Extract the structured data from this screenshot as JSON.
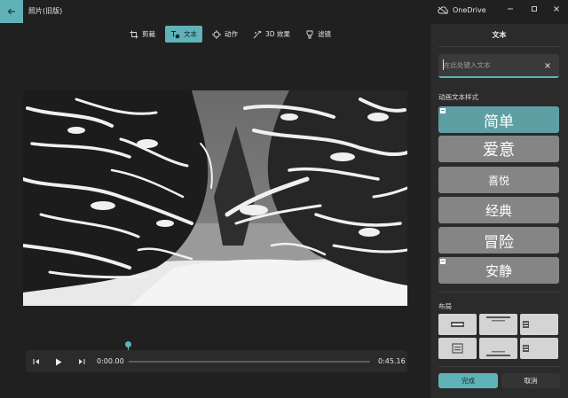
{
  "app": {
    "title": "照片(旧版)",
    "onedrive_label": "OneDrive"
  },
  "colors": {
    "accent": "#5fb3b8",
    "background": "#202020",
    "panel": "#2b2b2b",
    "style_button": "#858585"
  },
  "toolbar": {
    "tools": [
      {
        "label": "剪裁",
        "icon": "crop-icon",
        "active": false
      },
      {
        "label": "文本",
        "icon": "text-icon",
        "active": true
      },
      {
        "label": "动作",
        "icon": "motion-icon",
        "active": false
      },
      {
        "label": "3D 效果",
        "icon": "3d-effects-icon",
        "active": false
      },
      {
        "label": "滤镜",
        "icon": "filter-icon",
        "active": false
      }
    ]
  },
  "player": {
    "current_time": "0:00.00",
    "total_time": "0:45.16",
    "progress": 0
  },
  "panel": {
    "title": "文本",
    "text_input": {
      "value": "",
      "placeholder": "在此处键入文本"
    },
    "styles_label": "动画文本样式",
    "styles": [
      {
        "label": "简单",
        "selected": true
      },
      {
        "label": "爱意",
        "selected": false
      },
      {
        "label": "喜悦",
        "selected": false
      },
      {
        "label": "经典",
        "selected": false
      },
      {
        "label": "冒险",
        "selected": false
      },
      {
        "label": "安静",
        "selected": false
      }
    ],
    "layout_label": "布局",
    "done_label": "完成",
    "cancel_label": "取消"
  }
}
